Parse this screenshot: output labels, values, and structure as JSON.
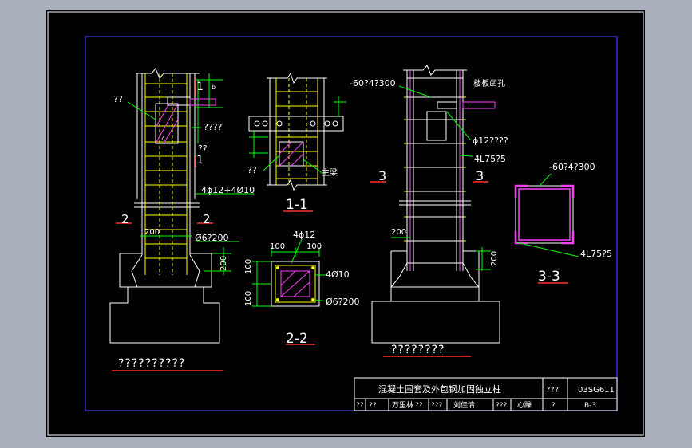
{
  "colors": {
    "viewport_bg": "#a9b0bb",
    "sheet_bg": "#000000",
    "frame_white": "#ffffff",
    "border_blue": "#3a3aff",
    "concrete_white": "#ffffff",
    "rebar_yellow": "#ffff00",
    "dim_green": "#00ff00",
    "steel_magenta": "#ff40ff",
    "label_white": "#ffffff",
    "underline_red": "#ff3030",
    "hatch_magenta": "#ff40ff",
    "cyan": "#00ffff"
  },
  "elevation_left": {
    "label_qq": "??",
    "label_marker_1": "1",
    "label_qqqq": "????",
    "label_qq_mid": "??",
    "label_rebar": "4ɸ12+4Ø10",
    "label_2_left": "2",
    "label_2_right": "2",
    "dim_200_top": "200",
    "label_stirrup": "Ø6?200",
    "dim_200_right": "200",
    "title": "??????????",
    "small_b": "b",
    "small_4": "4"
  },
  "section_1_1": {
    "label_qq": "??",
    "label_main": "主梁",
    "title": "1-1"
  },
  "section_2_2": {
    "label_top_rebar": "4ɸ12",
    "dim_100_a": "100",
    "dim_100_b": "100",
    "label_4010": "4Ø10",
    "label_stirrup": "Ø6?200",
    "dim_100_left_top": "100",
    "dim_100_left_bottom": "100",
    "title": "2-2"
  },
  "elevation_right": {
    "label_plate": "-60?4?300",
    "label_hole": "楼板凿孔",
    "label_bar": "ɸ12????",
    "label_angle": "4L75?5",
    "label_3_left": "3",
    "label_3_right": "3",
    "dim_200": "200",
    "dim_200_right": "200",
    "title": "????????"
  },
  "section_3_3": {
    "label_plate": "-60?4?300",
    "label_angle": "4L75?5",
    "title": "3-3"
  },
  "title_block": {
    "drawing_title": "混凝土围套及外包钢加固独立柱",
    "qq_label": "???",
    "atlas_no": "03SG611",
    "row2": [
      "??",
      "??",
      "万里林",
      "??",
      "???",
      "刘佳清",
      "???",
      "心躁",
      "?"
    ],
    "page": "B-3"
  }
}
